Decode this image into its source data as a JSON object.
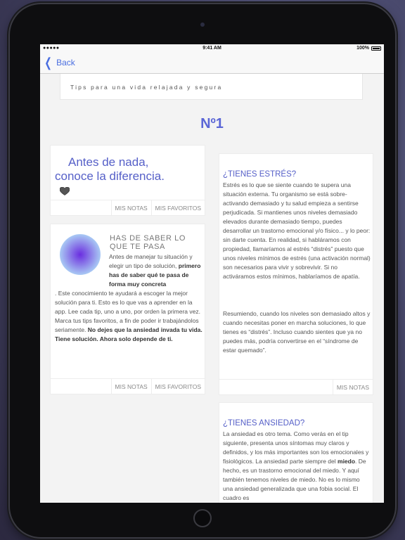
{
  "status_bar": {
    "signal": "●●●●● ",
    "time": "9:41 AM",
    "battery": "100%"
  },
  "nav": {
    "back_label": "Back"
  },
  "banner": {
    "text": "Tips para una vida relajada y segura"
  },
  "number": "Nº1",
  "card1": {
    "line1": "Antes de nada,",
    "line2": "conoce la diferencia."
  },
  "card2": {
    "title": "HAS DE SABER LO QUE TE PASA",
    "body_a": "Antes de manejar tu situación y elegir un tipo de solución, ",
    "body_b": "primero has de saber qué te pasa de forma muy concreta",
    "body_c": ". Este conocimiento te ayudará a escoger la mejor solución para ti. Esto es lo que vas a aprender en la app. Lee cada tip, uno a uno, por orden la primera vez. Marca tus tips favoritos, a fin de poder ir trabajándolos seriamente. ",
    "body_d": "No dejes que la ansiedad invada tu vida. Tiene solución. Ahora solo depende de ti."
  },
  "card3": {
    "heading": "¿TIENES ESTRÉS?",
    "p1": "Estrés es lo que se siente cuando te supera una situación externa. Tu organismo se está sobre-activando demasiado y tu salud empieza a sentirse perjudicada. Si mantienes unos niveles demasiado elevados durante demasiado tiempo, puedes desarrollar un trastorno emocional y/o físico... y lo peor:  sin darte cuenta. En realidad, si habláramos con propiedad, llamaríamos al estrés “distrés” puesto que unos niveles mínimos de estrés (una activación normal) son necesarios para vivir y sobrevivir. Si no activáramos estos mínimos, hablaríamos de apatía.",
    "p2": "Resumiendo, cuando los niveles son demasiado altos y cuando necesitas poner en marcha soluciones, lo que tienes es “distrés”. Incluso cuando sientes que ya no puedes más, podría convertirse en el “síndrome de estar quemado”."
  },
  "card4": {
    "heading": "¿TIENES ANSIEDAD?",
    "p_a": "La ansiedad es otro tema. Como verás en el tip siguiente, presenta unos síntomas muy claros y definidos, y los más importantes son los emocionales y fisiológicos. La ansiedad parte siempre del ",
    "p_b": "miedo",
    "p_c": ". De hecho, es un trastorno emocional del miedo. Y aquí también tenemos niveles de miedo. No es lo mismo una ansiedad generalizada que una fobia social. El cuadro es"
  },
  "actions": {
    "notes": "MIS NOTAS",
    "favorites": "MIS FAVORITOS"
  },
  "colors": {
    "accent": "#5b66d6",
    "link": "#4a6ee0"
  }
}
